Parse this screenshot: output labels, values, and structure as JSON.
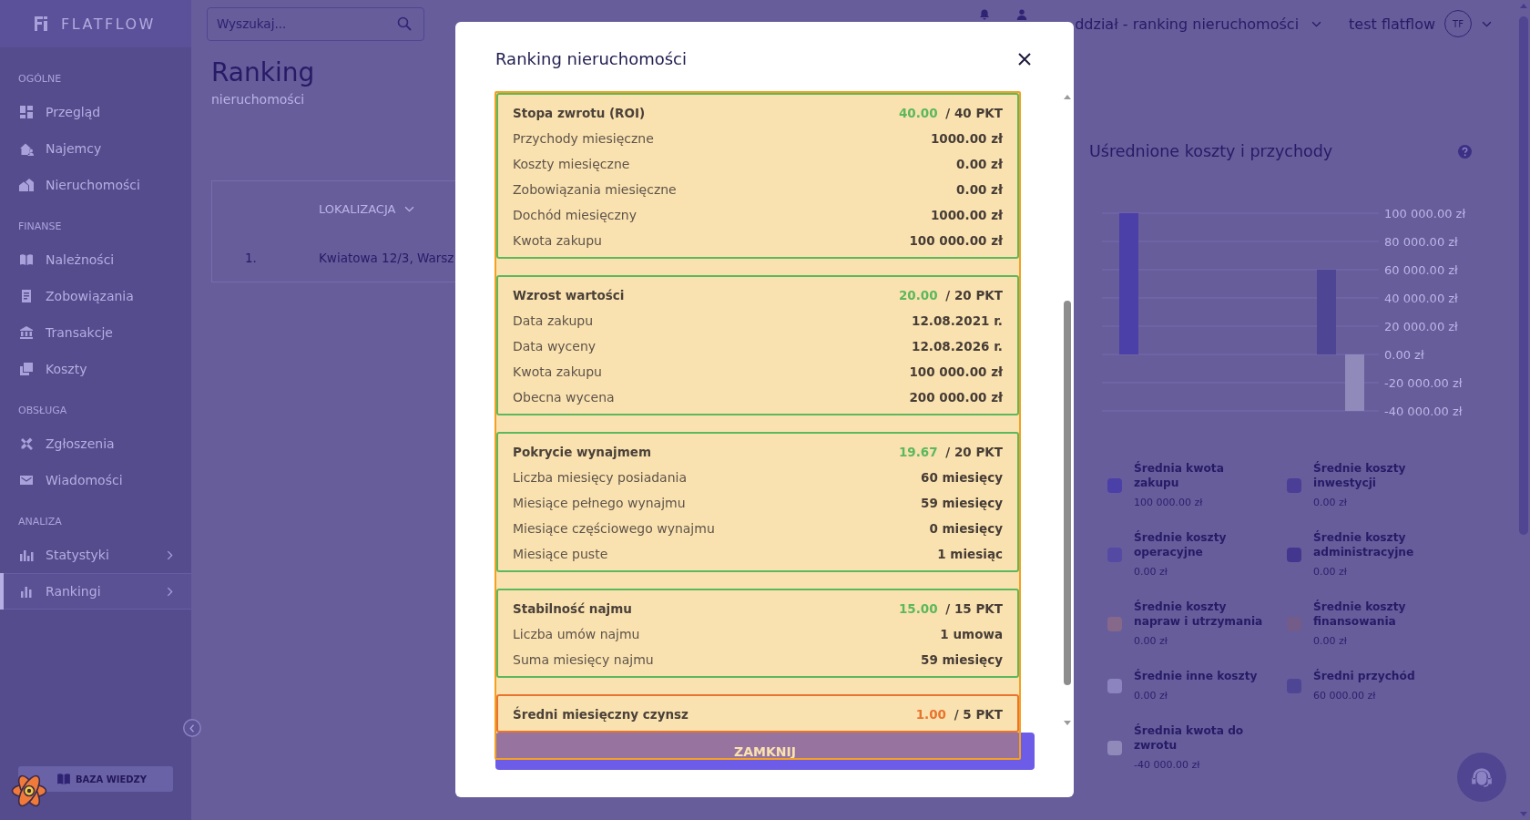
{
  "sidebar": {
    "logo": "FLATFLOW",
    "sections": [
      {
        "title": "OGÓLNE",
        "items": [
          {
            "label": "Przegląd",
            "kind": "link",
            "selected": false
          },
          {
            "label": "Najemcy",
            "kind": "link",
            "selected": false
          },
          {
            "label": "Nieruchomości",
            "kind": "link",
            "selected": false
          }
        ]
      },
      {
        "title": "FINANSE",
        "items": [
          {
            "label": "Należności",
            "kind": "link",
            "selected": false
          },
          {
            "label": "Zobowiązania",
            "kind": "link",
            "selected": false
          },
          {
            "label": "Transakcje",
            "kind": "link",
            "selected": false
          },
          {
            "label": "Koszty",
            "kind": "link",
            "selected": false
          }
        ]
      },
      {
        "title": "OBSŁUGA",
        "items": [
          {
            "label": "Zgłoszenia",
            "kind": "link",
            "selected": false
          },
          {
            "label": "Wiadomości",
            "kind": "link",
            "selected": false
          }
        ]
      },
      {
        "title": "ANALIZA",
        "items": [
          {
            "label": "Statystyki",
            "kind": "submenu",
            "selected": false
          },
          {
            "label": "Rankingi",
            "kind": "submenu",
            "selected": true
          }
        ]
      }
    ],
    "knowledge_base_button": "BAZA WIEDZY"
  },
  "topbar": {
    "search": {
      "placeholder": "Wyszukaj..."
    },
    "branch": "ddział - ranking nieruchomości",
    "user": {
      "name": "test flatflow",
      "initials": "TF"
    }
  },
  "page": {
    "title": "Ranking",
    "subtitle": "nieruchomości"
  },
  "table": {
    "columns": [
      "LOKALIZACJA"
    ],
    "rows": [
      {
        "rank": "1.",
        "location": "Kwiatowa 12/3, Warsz"
      }
    ]
  },
  "chart_panel": {
    "title": "Uśrednione koszty i przychody",
    "chart_data": {
      "type": "bar",
      "stacked": false,
      "grid": true,
      "series": [
        {
          "name": "Średnia kwota zakupu",
          "color": "#4b3fa8",
          "values": [
            100000
          ]
        },
        {
          "name": "Średnie koszty inwestycji",
          "color": "#4a3e96",
          "values": [
            0
          ]
        },
        {
          "name": "Średnie koszty operacyjne",
          "color": "#544aa3",
          "values": [
            0
          ]
        },
        {
          "name": "Średnie koszty administracyjne",
          "color": "#43368f",
          "values": [
            0
          ]
        },
        {
          "name": "Średnie koszty napraw i utrzymania",
          "color": "#86698a",
          "values": [
            0
          ]
        },
        {
          "name": "Średnie koszty finansowania",
          "color": "#735b8a",
          "values": [
            0
          ]
        },
        {
          "name": "Średnie inne koszty",
          "color": "#8c84be",
          "values": [
            0
          ]
        },
        {
          "name": "Średni przychód",
          "color": "#4e4594",
          "values": [
            60000
          ]
        },
        {
          "name": "Średnia kwota do zwrotu",
          "color": "#908abb",
          "values": [
            -40000
          ]
        }
      ],
      "ylim": [
        -40000,
        100000
      ],
      "yticks": [
        {
          "value": 100000,
          "label": "100 000.00 zł"
        },
        {
          "value": 80000,
          "label": "80 000.00 zł"
        },
        {
          "value": 60000,
          "label": "60 000.00 zł"
        },
        {
          "value": 40000,
          "label": "40 000.00 zł"
        },
        {
          "value": 20000,
          "label": "20 000.00 zł"
        },
        {
          "value": 0,
          "label": "0.00 zł"
        },
        {
          "value": -20000,
          "label": "-20 000.00 zł"
        },
        {
          "value": -40000,
          "label": "-40 000.00 zł"
        }
      ]
    },
    "legend_values": [
      "100 000.00 zł",
      "0.00 zł",
      "0.00 zł",
      "0.00 zł",
      "0.00 zł",
      "0.00 zł",
      "0.00 zł",
      "60 000.00 zł",
      "-40 000.00 zł"
    ]
  },
  "modal": {
    "title": "Ranking nieruchomości",
    "sections": [
      {
        "title": "Stopa zwrotu (ROI)",
        "score": "40.00",
        "max": "/ 40 PKT",
        "color": "#5cb85c",
        "rows": [
          {
            "label": "Przychody miesięczne",
            "value": "1000.00 zł"
          },
          {
            "label": "Koszty miesięczne",
            "value": "0.00 zł"
          },
          {
            "label": "Zobowiązania miesięczne",
            "value": "0.00 zł"
          },
          {
            "label": "Dochód miesięczny",
            "value": "1000.00 zł"
          },
          {
            "label": "Kwota zakupu",
            "value": "100 000.00 zł"
          }
        ]
      },
      {
        "title": "Wzrost wartości",
        "score": "20.00",
        "max": "/ 20 PKT",
        "color": "#5cb85c",
        "rows": [
          {
            "label": "Data zakupu",
            "value": "12.08.2021 r."
          },
          {
            "label": "Data wyceny",
            "value": "12.08.2026 r."
          },
          {
            "label": "Kwota zakupu",
            "value": "100 000.00 zł"
          },
          {
            "label": "Obecna wycena",
            "value": "200 000.00 zł"
          }
        ]
      },
      {
        "title": "Pokrycie wynajmem",
        "score": "19.67",
        "max": "/ 20 PKT",
        "color": "#5cb85c",
        "rows": [
          {
            "label": "Liczba miesięcy posiadania",
            "value": "60 miesięcy"
          },
          {
            "label": "Miesiące pełnego wynajmu",
            "value": "59 miesięcy"
          },
          {
            "label": "Miesiące częściowego wynajmu",
            "value": "0 miesięcy"
          },
          {
            "label": "Miesiące puste",
            "value": "1 miesiąc"
          }
        ]
      },
      {
        "title": "Stabilność najmu",
        "score": "15.00",
        "max": "/ 15 PKT",
        "color": "#5cb85c",
        "rows": [
          {
            "label": "Liczba umów najmu",
            "value": "1 umowa"
          },
          {
            "label": "Suma miesięcy najmu",
            "value": "59 miesięcy"
          }
        ]
      },
      {
        "title": "Średni miesięczny czynsz",
        "score": "1.00",
        "max": "/ 5 PKT",
        "color": "#e8742f"
      }
    ],
    "close_button": "ZAMKNIJ"
  }
}
